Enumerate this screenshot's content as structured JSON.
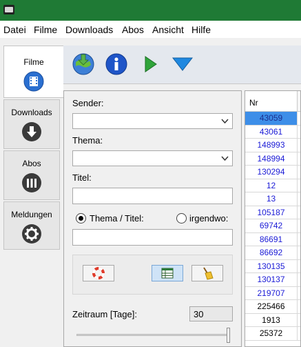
{
  "menubar": {
    "items": [
      "Datei",
      "Filme",
      "Downloads",
      "Abos",
      "Ansicht",
      "Hilfe"
    ]
  },
  "left_tabs": [
    {
      "label": "Filme",
      "icon": "film-icon",
      "active": true
    },
    {
      "label": "Downloads",
      "icon": "download-icon",
      "active": false
    },
    {
      "label": "Abos",
      "icon": "abos-icon",
      "active": false
    },
    {
      "label": "Meldungen",
      "icon": "gear-icon",
      "active": false
    }
  ],
  "toolbar": {
    "buttons": [
      "load-filmlist-icon",
      "info-icon",
      "play-icon",
      "filter-icon"
    ]
  },
  "filter": {
    "sender_label": "Sender:",
    "sender_value": "",
    "thema_label": "Thema:",
    "thema_value": "",
    "titel_label": "Titel:",
    "titel_value": "",
    "radio_thema_titel": "Thema / Titel:",
    "radio_irgendwo": "irgendwo:",
    "search_value": "",
    "zeitraum_label": "Zeitraum [Tage]:",
    "zeitraum_value": "30",
    "zeitraum_fraction": 1.0
  },
  "table": {
    "column_header": "Nr",
    "rows": [
      {
        "nr": "43059",
        "selected": true,
        "blue": true
      },
      {
        "nr": "43061",
        "selected": false,
        "blue": true
      },
      {
        "nr": "148993",
        "selected": false,
        "blue": true
      },
      {
        "nr": "148994",
        "selected": false,
        "blue": true
      },
      {
        "nr": "130294",
        "selected": false,
        "blue": true
      },
      {
        "nr": "12",
        "selected": false,
        "blue": true
      },
      {
        "nr": "13",
        "selected": false,
        "blue": true
      },
      {
        "nr": "105187",
        "selected": false,
        "blue": true
      },
      {
        "nr": "69742",
        "selected": false,
        "blue": true
      },
      {
        "nr": "86691",
        "selected": false,
        "blue": true
      },
      {
        "nr": "86692",
        "selected": false,
        "blue": true
      },
      {
        "nr": "130135",
        "selected": false,
        "blue": true
      },
      {
        "nr": "130137",
        "selected": false,
        "blue": true
      },
      {
        "nr": "219707",
        "selected": false,
        "blue": true
      },
      {
        "nr": "225466",
        "selected": false,
        "blue": false
      },
      {
        "nr": "1913",
        "selected": false,
        "blue": false
      },
      {
        "nr": "25372",
        "selected": false,
        "blue": false
      }
    ]
  },
  "colors": {
    "titlebar": "#1f7a35",
    "selection": "#3d8ee8",
    "link_blue": "#1a1ad6"
  }
}
